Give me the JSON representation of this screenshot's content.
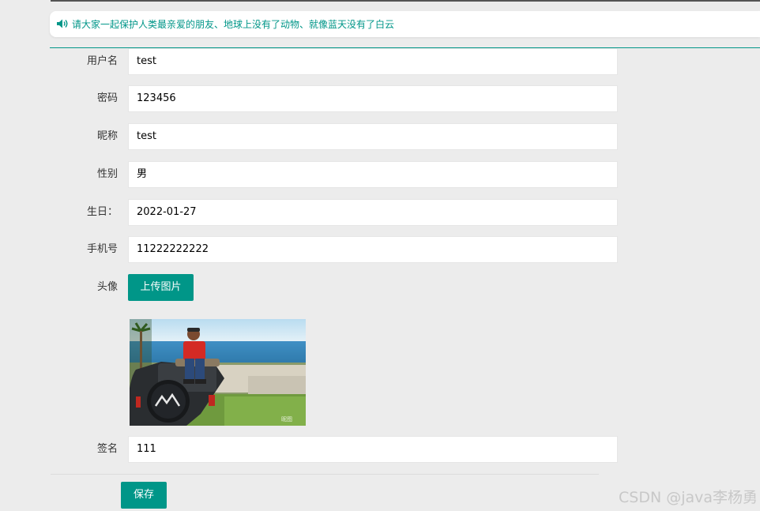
{
  "notice": {
    "icon": "speaker-icon",
    "text": "请大家一起保护人类最亲爱的朋友、地球上没有了动物、就像蓝天没有了白云"
  },
  "form": {
    "username": {
      "label": "用户名",
      "value": "test"
    },
    "password": {
      "label": "密码",
      "value": "123456"
    },
    "nickname": {
      "label": "昵称",
      "value": "test"
    },
    "gender": {
      "label": "性别",
      "value": "男"
    },
    "birthday": {
      "label": "生日：",
      "value": "2022-01-27"
    },
    "phone": {
      "label": "手机号",
      "value": "11222222222"
    },
    "avatar": {
      "label": "头像",
      "upload_label": "上传图片"
    },
    "signature": {
      "label": "签名",
      "value": "111"
    }
  },
  "save_label": "保存",
  "watermark": "CSDN @java李杨勇",
  "colors": {
    "accent": "#009688",
    "background": "#ececec"
  }
}
